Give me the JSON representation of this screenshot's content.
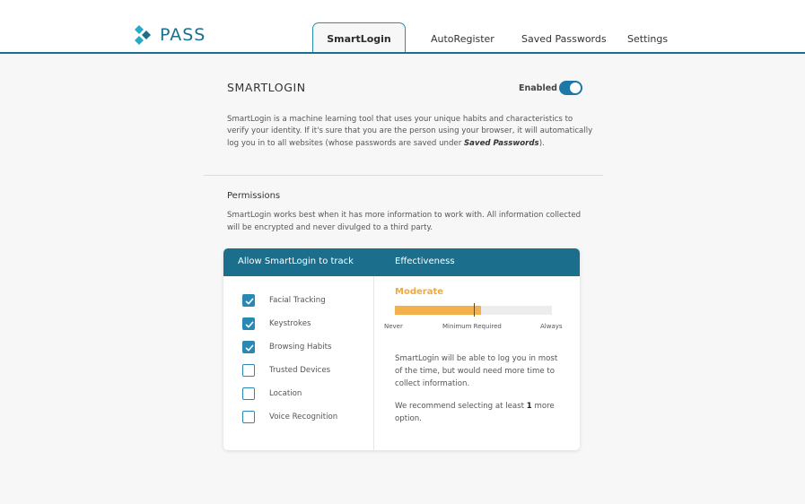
{
  "brand": {
    "name": "PASS",
    "accent": "#1b6f8d",
    "logo_icon": "diamond-cluster-icon"
  },
  "nav": {
    "tabs": [
      {
        "label": "SmartLogin",
        "active": true
      },
      {
        "label": "AutoRegister",
        "active": false
      },
      {
        "label": "Saved Passwords",
        "active": false
      },
      {
        "label": "Settings",
        "active": false
      }
    ]
  },
  "smartlogin": {
    "title": "SMARTLOGIN",
    "status_label": "Enabled",
    "enabled": true,
    "description_pre": "SmartLogin is a machine learning tool that uses your unique habits and characteristics to verify your identity. If it's sure that you are the person using your browser, it will automatically log you in to all websites (whose passwords are saved under ",
    "description_emph": "Saved Passwords",
    "description_post": ")."
  },
  "permissions": {
    "title": "Permissions",
    "description": "SmartLogin works best when it has more information to work with. All information collected will be encrypted and never divulged to a third party.",
    "table_header_left": "Allow SmartLogin to track",
    "table_header_right": "Effectiveness",
    "items": [
      {
        "label": "Facial Tracking",
        "checked": true
      },
      {
        "label": "Keystrokes",
        "checked": true
      },
      {
        "label": "Browsing Habits",
        "checked": true
      },
      {
        "label": "Trusted Devices",
        "checked": false
      },
      {
        "label": "Location",
        "checked": false
      },
      {
        "label": "Voice Recognition",
        "checked": false
      }
    ]
  },
  "effectiveness": {
    "level": "Moderate",
    "level_color": "#f3a93a",
    "fill_fraction": 0.55,
    "minimum_fraction": 0.5,
    "scale_min_label": "Never",
    "scale_mid_label": "Minimum Required",
    "scale_max_label": "Always",
    "summary": "SmartLogin will be able to log you in most of the time, but would need more time to collect information.",
    "recommend_pre": "We recommend selecting at least ",
    "recommend_count": "1",
    "recommend_post": " more option."
  }
}
